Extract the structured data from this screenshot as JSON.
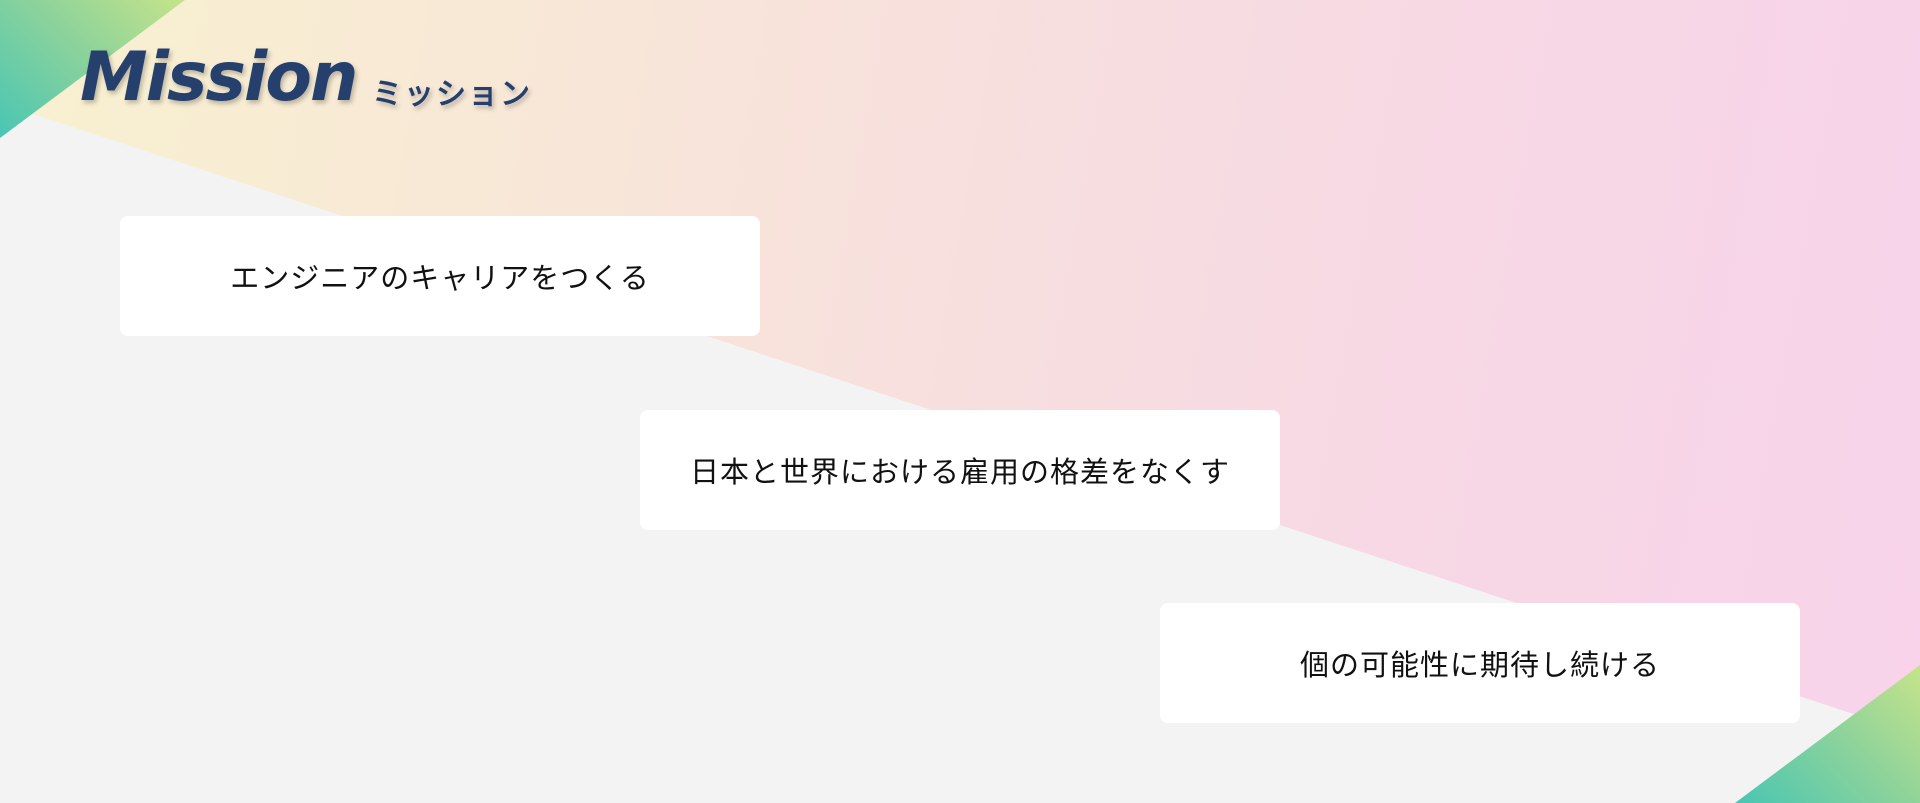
{
  "header": {
    "title": "Mission",
    "subtitle": "ミッション"
  },
  "missions": [
    {
      "text": "エンジニアのキャリアをつくる"
    },
    {
      "text": "日本と世界における雇用の格差をなくす"
    },
    {
      "text": "個の可能性に期待し続ける"
    }
  ],
  "colors": {
    "title": "#26406e",
    "background": "#f3f3f3",
    "band_start": "#f8f1cf",
    "band_end": "#f8d3eb",
    "corner_teal": "#49c6b3",
    "corner_lime": "#c6e48a",
    "card": "#ffffff",
    "card_text": "#111111"
  }
}
